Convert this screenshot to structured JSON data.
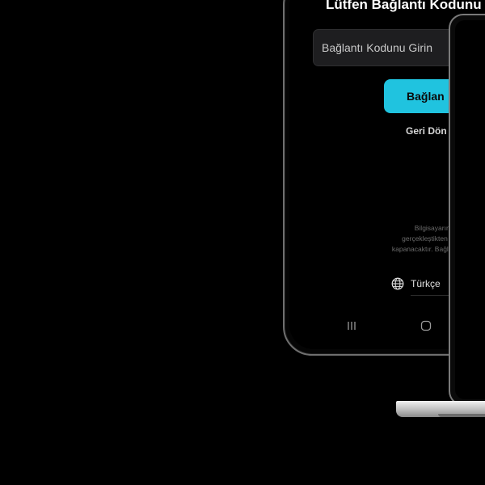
{
  "app": {
    "title": "Lütfen Bağlantı Kodunu",
    "code_input": {
      "placeholder": "Bağlantı Kodunu Girin",
      "value": ""
    },
    "connect_label": "Bağlan",
    "back_label": "Geri Dön",
    "info_lines": [
      "Bilgisayarınızdaki kodu telefonunuz",
      "gerçekleştikten sonra bilgisayardaki ara",
      "kapanacaktır. Bağlantıyı kestiğinizde arayü"
    ],
    "language": {
      "selected": "Türkçe",
      "icon": "globe-icon"
    },
    "accent_color": "#20c3df"
  }
}
